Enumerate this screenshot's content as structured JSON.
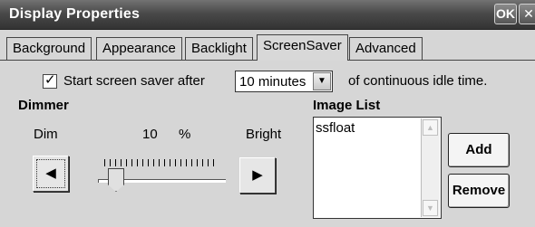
{
  "window": {
    "title": "Display Properties",
    "ok_label": "OK",
    "close_label": "✕"
  },
  "tabs": [
    {
      "label": "Background",
      "active": false
    },
    {
      "label": "Appearance",
      "active": false
    },
    {
      "label": "Backlight",
      "active": false
    },
    {
      "label": "ScreenSaver",
      "active": true
    },
    {
      "label": "Advanced",
      "active": false
    }
  ],
  "screensaver": {
    "checkbox_checked": true,
    "check_glyph": "✓",
    "start_label": "Start screen saver after",
    "timeout_value": "10 minutes",
    "idle_label": "of continuous idle time."
  },
  "dimmer": {
    "heading": "Dimmer",
    "dim_label": "Dim",
    "bright_label": "Bright",
    "value": "10",
    "unit": "%",
    "dim_button_glyph": "◀",
    "bright_button_glyph": "▶",
    "level_fraction": 0.1
  },
  "image_list": {
    "heading": "Image List",
    "items": [
      "ssfloat"
    ],
    "add_label": "Add",
    "remove_label": "Remove"
  },
  "icons": {
    "combo_arrow": "chevron-down-icon",
    "scroll_up": "chevron-up-icon",
    "scroll_down": "chevron-down-icon"
  }
}
